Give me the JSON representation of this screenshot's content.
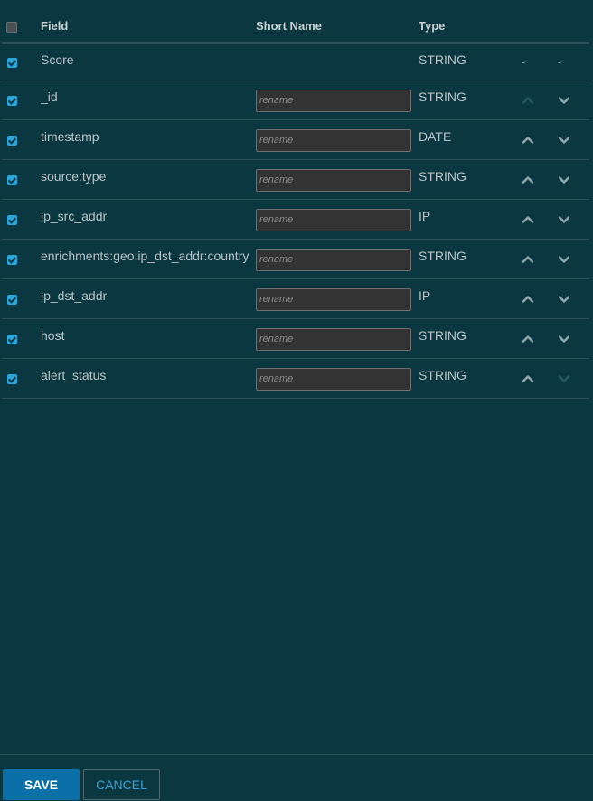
{
  "header": {
    "field": "Field",
    "short_name": "Short Name",
    "type": "Type",
    "select_all_checked": false
  },
  "rows": [
    {
      "checked": true,
      "field": "Score",
      "type": "STRING",
      "has_input": false,
      "up": "-",
      "down": "-"
    },
    {
      "checked": true,
      "field": "_id",
      "type": "STRING",
      "has_input": true,
      "placeholder": "rename",
      "up_enabled": false,
      "down_enabled": true
    },
    {
      "checked": true,
      "field": "timestamp",
      "type": "DATE",
      "has_input": true,
      "placeholder": "rename",
      "up_enabled": true,
      "down_enabled": true
    },
    {
      "checked": true,
      "field": "source:type",
      "type": "STRING",
      "has_input": true,
      "placeholder": "rename",
      "up_enabled": true,
      "down_enabled": true
    },
    {
      "checked": true,
      "field": "ip_src_addr",
      "type": "IP",
      "has_input": true,
      "placeholder": "rename",
      "up_enabled": true,
      "down_enabled": true
    },
    {
      "checked": true,
      "field": "enrichments:geo:ip_dst_addr:country",
      "type": "STRING",
      "has_input": true,
      "placeholder": "rename",
      "up_enabled": true,
      "down_enabled": true
    },
    {
      "checked": true,
      "field": "ip_dst_addr",
      "type": "IP",
      "has_input": true,
      "placeholder": "rename",
      "up_enabled": true,
      "down_enabled": true
    },
    {
      "checked": true,
      "field": "host",
      "type": "STRING",
      "has_input": true,
      "placeholder": "rename",
      "up_enabled": true,
      "down_enabled": true
    },
    {
      "checked": true,
      "field": "alert_status",
      "type": "STRING",
      "has_input": true,
      "placeholder": "rename",
      "up_enabled": true,
      "down_enabled": false
    }
  ],
  "footer": {
    "save_label": "SAVE",
    "cancel_label": "CANCEL"
  },
  "icons": {
    "up": "chevron-up-icon",
    "down": "chevron-down-icon",
    "checkbox": "checkbox-icon"
  },
  "colors": {
    "background": "#0b3740",
    "accent": "#2aa6db",
    "save_button": "#0b6fa8",
    "cancel_text": "#39a3d8"
  }
}
